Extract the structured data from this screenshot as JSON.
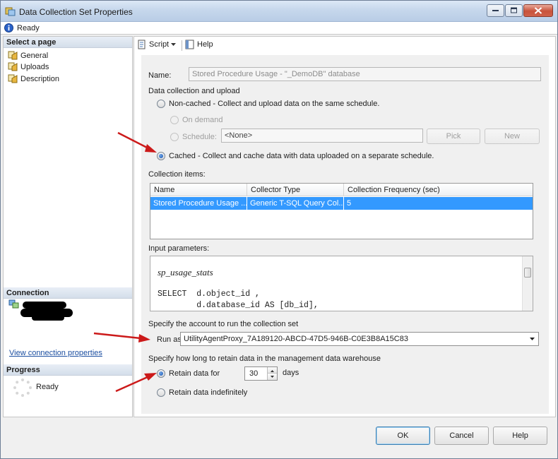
{
  "window": {
    "title": "Data Collection Set Properties",
    "status": "Ready"
  },
  "left_pane": {
    "select_page_header": "Select a page",
    "pages": [
      {
        "label": "General"
      },
      {
        "label": "Uploads"
      },
      {
        "label": "Description"
      }
    ],
    "connection_header": "Connection",
    "view_connection_link": "View connection properties",
    "progress_header": "Progress",
    "progress_status": "Ready"
  },
  "toolbar": {
    "script_label": "Script",
    "help_label": "Help"
  },
  "form": {
    "name_label": "Name:",
    "name_value": "Stored Procedure Usage - \"_DemoDB\" database",
    "data_collection_label": "Data collection and upload",
    "noncached_label": "Non-cached - Collect and upload data on the same schedule.",
    "on_demand_label": "On demand",
    "schedule_label": "Schedule:",
    "schedule_value": "<None>",
    "pick_label": "Pick",
    "new_label": "New",
    "cached_label": "Cached - Collect and cache data with data uploaded on a separate schedule.",
    "collection_items_label": "Collection items:",
    "grid": {
      "columns": [
        "Name",
        "Collector Type",
        "Collection Frequency (sec)"
      ],
      "rows": [
        [
          "Stored Procedure Usage ...",
          "Generic T-SQL Query Col...",
          "5"
        ]
      ]
    },
    "input_parameters_label": "Input parameters:",
    "code_lines": [
      "sp_usage_stats",
      "SELECT  d.object_id ,",
      "        d.database_id AS [db_id],"
    ],
    "account_label": "Specify the account to run the collection set",
    "run_as_label": "Run as:",
    "run_as_value": "UtilityAgentProxy_7A189120-ABCD-47D5-946B-C0E3B8A15C83",
    "retention_label": "Specify how long to retain data in the management data warehouse",
    "retain_for_label": "Retain data for",
    "retain_days_value": "30",
    "days_label": "days",
    "retain_indefinitely_label": "Retain data indefinitely"
  },
  "buttons": {
    "ok": "OK",
    "cancel": "Cancel",
    "help": "Help"
  },
  "colors": {
    "selection": "#3399ff",
    "annotation_arrow": "#cc1a1a",
    "link": "#1b4ea0"
  }
}
